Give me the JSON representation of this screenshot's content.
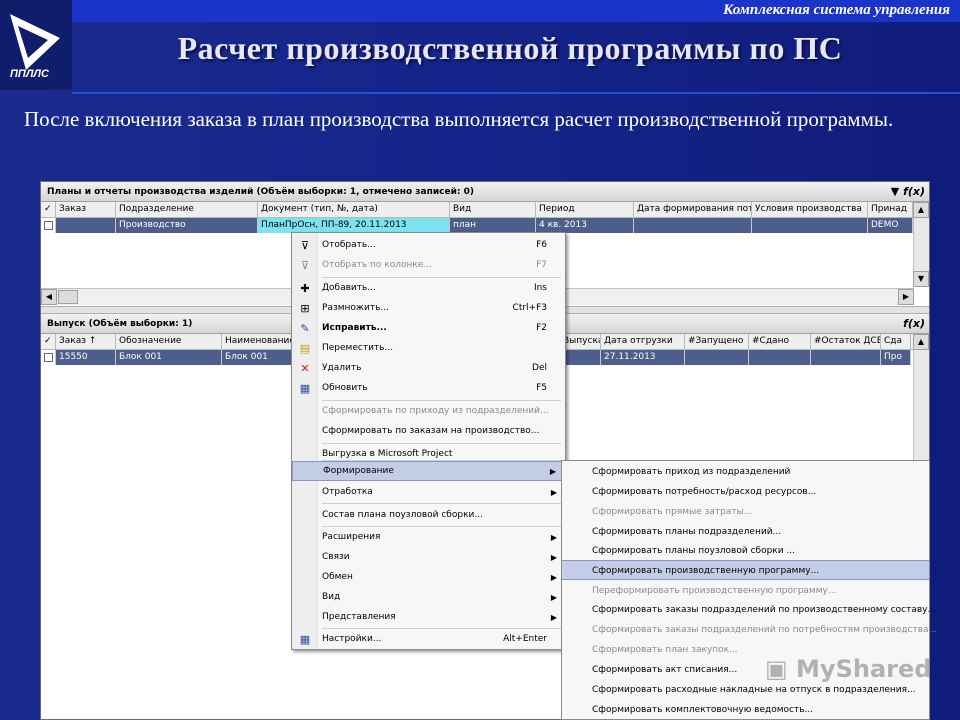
{
  "header": {
    "system_label": "Комплексная система управления",
    "logo_text": "ППЛЛС",
    "title": "Расчет производственной программы по ПС"
  },
  "intro": "После включения заказа в план производства выполняется расчет производственной программы.",
  "top_panel": {
    "title": "Планы и отчеты производства изделий (Объём выборки: 1, отмечено записей: 0)",
    "tools": "f(x)",
    "columns": [
      "Заказ",
      "Подразделение",
      "Документ (тип, №, дата)",
      "Вид",
      "Период",
      "Дата формирования пот",
      "Условия производства",
      "Принад"
    ],
    "row": [
      "",
      "Производство",
      "ПланПрОсн, ПП-89, 20.11.2013",
      "план",
      "4 кв. 2013",
      "",
      "",
      "DEMO"
    ]
  },
  "bottom_panel": {
    "title": "Выпуск (Объём выборки: 1)",
    "tools": "f(x)",
    "columns": [
      "Заказ",
      "Обозначение",
      "Наименование",
      "Выпуска",
      "Дата отгрузки",
      "#Запущено",
      "#Сдано",
      "#Остаток ДСЕ",
      "Сда"
    ],
    "row": [
      "15550",
      "Блок 001",
      "Блок 001",
      "",
      "27.11.2013",
      "",
      "",
      "",
      "Про"
    ]
  },
  "context_menu": {
    "items": [
      {
        "label": "Отобрать...",
        "shortcut": "F6"
      },
      {
        "label": "Отобрать по колонке...",
        "shortcut": "F7"
      },
      {
        "label": "Добавить...",
        "shortcut": "Ins"
      },
      {
        "label": "Размножить...",
        "shortcut": "Ctrl+F3"
      },
      {
        "label": "Исправить...",
        "shortcut": "F2"
      },
      {
        "label": "Переместить...",
        "shortcut": ""
      },
      {
        "label": "Удалить",
        "shortcut": "Del"
      },
      {
        "label": "Обновить",
        "shortcut": "F5"
      },
      {
        "label": "Сформировать по приходу из подразделений...",
        "shortcut": ""
      },
      {
        "label": "Сформировать по заказам на производство...",
        "shortcut": ""
      },
      {
        "label": "Выгрузка в Microsoft Project",
        "shortcut": ""
      },
      {
        "label": "Формирование",
        "shortcut": ""
      },
      {
        "label": "Отработка",
        "shortcut": ""
      },
      {
        "label": "Состав плана поузловой сборки...",
        "shortcut": ""
      },
      {
        "label": "Расширения",
        "shortcut": ""
      },
      {
        "label": "Связи",
        "shortcut": ""
      },
      {
        "label": "Обмен",
        "shortcut": ""
      },
      {
        "label": "Вид",
        "shortcut": ""
      },
      {
        "label": "Представления",
        "shortcut": ""
      },
      {
        "label": "Настройки...",
        "shortcut": "Alt+Enter"
      }
    ]
  },
  "submenu": {
    "items": [
      "Сформировать приход из подразделений",
      "Сформировать потребность/расход ресурсов...",
      "Сформировать прямые затраты...",
      "Сформировать планы подразделений...",
      "Сформировать планы поузловой сборки ...",
      "Сформировать производственную программу...",
      "Переформировать производственную программу...",
      "Сформировать заказы подразделений по производственному составу...",
      "Сформировать заказы подразделений по потребностям производства...",
      "Сформировать план закупок...",
      "Сформировать акт списания...",
      "Сформировать расходные накладные на отпуск в подразделения...",
      "Сформировать комплектовочную ведомость..."
    ]
  },
  "watermark": "MyShared"
}
